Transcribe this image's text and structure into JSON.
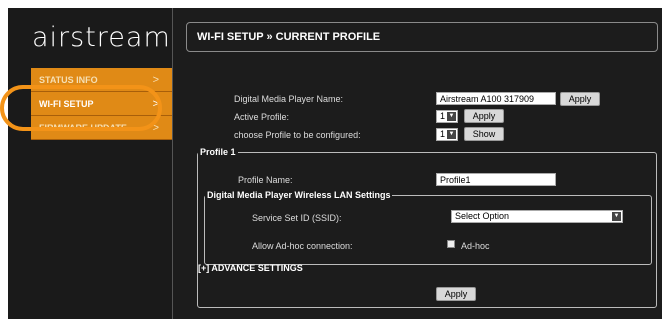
{
  "sidebar": {
    "logo": "airstream",
    "items": [
      {
        "label": "STATUS INFO",
        "chevron": ">"
      },
      {
        "label": "WI-FI SETUP",
        "chevron": ">"
      },
      {
        "label": "FIRMWARE UPDATE",
        "chevron": ">"
      }
    ]
  },
  "header": {
    "title": "WI-FI SETUP » CURRENT PROFILE"
  },
  "form": {
    "player_name_label": "Digital Media Player Name:",
    "player_name_value": "Airstream A100 317909",
    "apply_label": "Apply",
    "active_profile_label": "Active Profile:",
    "active_profile_value": "1",
    "choose_profile_label": "choose Profile to be configured:",
    "choose_profile_value": "1",
    "show_label": "Show"
  },
  "profile": {
    "legend": "Profile 1",
    "name_label": "Profile Name:",
    "name_value": "Profile1",
    "wlan_legend": "Digital Media Player Wireless LAN Settings",
    "ssid_label": "Service Set ID (SSID):",
    "ssid_value": "Select Option",
    "adhoc_label": "Allow Ad-hoc connection:",
    "adhoc_checkbox_label": "Ad-hoc",
    "advance_settings": "[+] ADVANCE SETTINGS",
    "apply_label": "Apply"
  },
  "colors": {
    "accent": "#e08a16",
    "highlight_ring": "#f39318",
    "background": "#1c1c1c"
  }
}
